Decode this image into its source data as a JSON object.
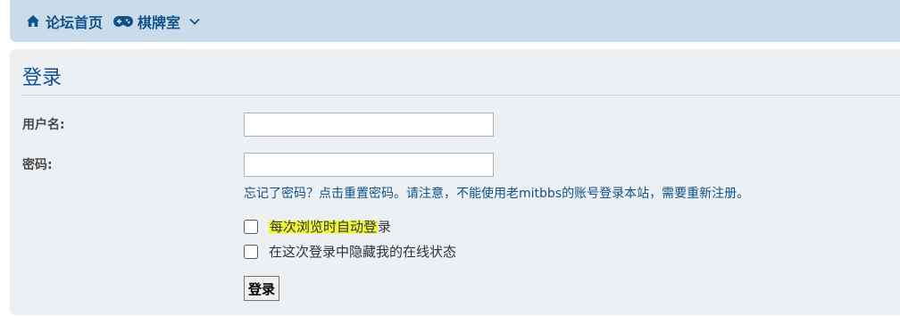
{
  "nav": {
    "home_label": "论坛首页",
    "board_label": "棋牌室",
    "home_icon": "home-icon",
    "board_icon": "gamepad-icon",
    "menu_icon": "chevron-down-icon"
  },
  "login": {
    "title": "登录",
    "username_label": "用户名:",
    "username_value": "",
    "password_label": "密码:",
    "password_value": "",
    "forgot_link": "忘记了密码？",
    "forgot_text": "点击重置密码。请注意，不能使用老mitbbs的账号登录本站，需要重新注册。",
    "autologin_label_highlighted": "每次浏览时自动登",
    "autologin_label_rest": "录",
    "hide_status_label": "在这次登录中隐藏我的在线状态",
    "submit_label": "登录"
  },
  "colors": {
    "navbar_bg": "#cadcea",
    "panel_bg": "#ecf0f3",
    "link": "#105289",
    "highlight": "#eef43c"
  }
}
